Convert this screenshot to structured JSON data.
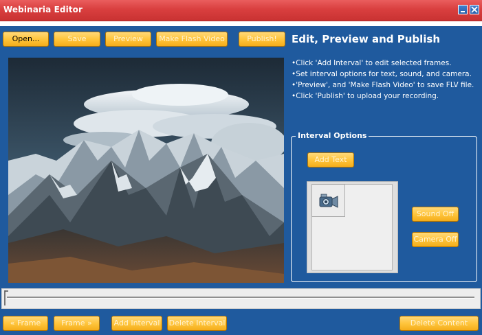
{
  "window": {
    "title": "Webinaria Editor",
    "minimize_icon": "minimize-icon",
    "close_icon": "close-icon"
  },
  "toolbar": {
    "open": "Open...",
    "save": "Save",
    "preview": "Preview",
    "make_flash": "Make Flash Video",
    "publish": "Publish!"
  },
  "header": {
    "title": "Edit, Preview and Publish",
    "instructions": [
      "Click 'Add Interval' to edit selected frames.",
      "Set interval options for text, sound, and camera.",
      "'Preview', and 'Make Flash Video' to save FLV file.",
      "Click 'Publish' to upload your recording."
    ]
  },
  "interval_options": {
    "label": "Interval Options",
    "add_text": "Add Text",
    "sound_off": "Sound Off",
    "camera_off": "Camera Off",
    "thumbnail_icon": "camcorder-icon"
  },
  "bottom": {
    "prev_frame": "« Frame",
    "next_frame": "Frame »",
    "add_interval": "Add Interval",
    "delete_interval": "Delete Interval",
    "delete_content": "Delete Content"
  },
  "colors": {
    "title_bar": "#d93f3f",
    "panel": "#1f5a9e",
    "button": "#ffc53d"
  }
}
